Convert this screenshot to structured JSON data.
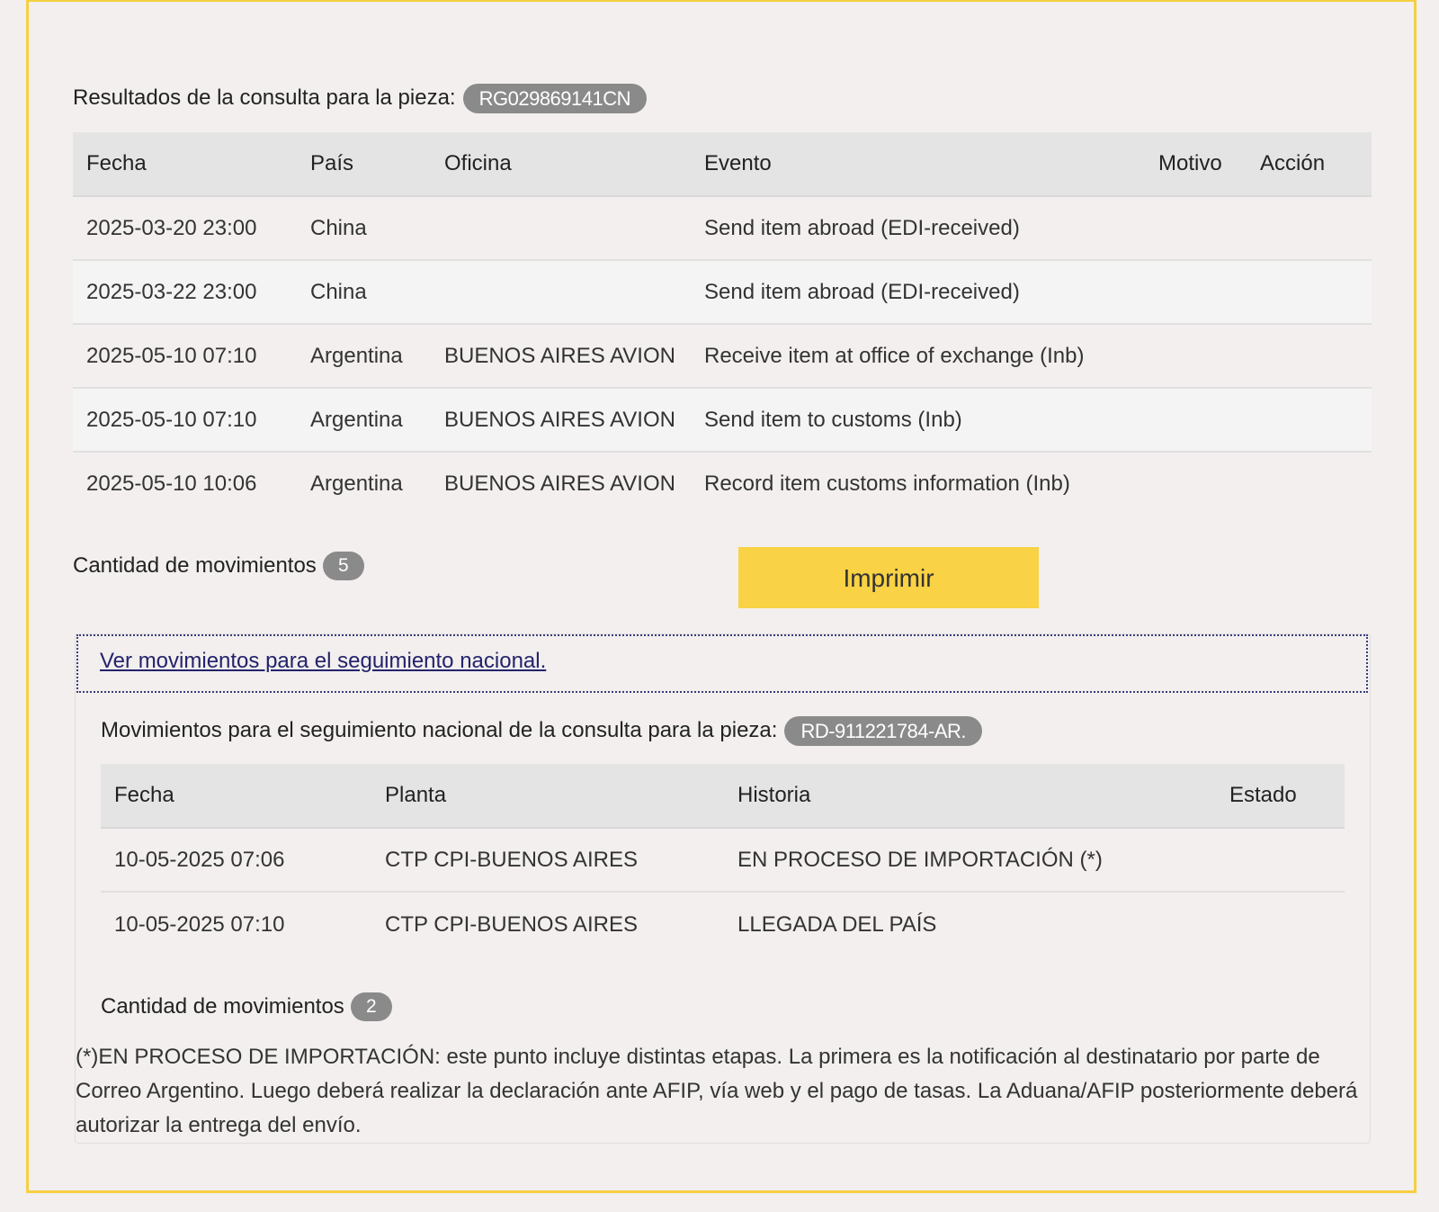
{
  "query": {
    "label": "Resultados de la consulta para la pieza:",
    "piece_id": "RG029869141CN"
  },
  "main_table": {
    "headers": [
      "Fecha",
      "País",
      "Oficina",
      "Evento",
      "Motivo",
      "Acción"
    ],
    "rows": [
      [
        "2025-03-20 23:00",
        "China",
        "",
        "Send item abroad (EDI-received)",
        "",
        ""
      ],
      [
        "2025-03-22 23:00",
        "China",
        "",
        "Send item abroad (EDI-received)",
        "",
        ""
      ],
      [
        "2025-05-10 07:10",
        "Argentina",
        "BUENOS AIRES AVION",
        "Receive item at office of exchange (Inb)",
        "",
        ""
      ],
      [
        "2025-05-10 07:10",
        "Argentina",
        "BUENOS AIRES AVION",
        "Send item to customs (Inb)",
        "",
        ""
      ],
      [
        "2025-05-10 10:06",
        "Argentina",
        "BUENOS AIRES AVION",
        "Record item customs information (Inb)",
        "",
        ""
      ]
    ]
  },
  "main_count": {
    "label": "Cantidad de movimientos",
    "value": "5"
  },
  "print_button": "Imprimir",
  "national": {
    "link_text": "Ver movimientos para el seguimiento nacional.",
    "title_label": "Movimientos para el seguimiento nacional de la consulta para la pieza:",
    "piece_id": "RD-911221784-AR.",
    "headers": [
      "Fecha",
      "Planta",
      "Historia",
      "Estado"
    ],
    "rows": [
      [
        "10-05-2025 07:06",
        "CTP CPI-BUENOS AIRES",
        "EN PROCESO DE IMPORTACIÓN (*)",
        ""
      ],
      [
        "10-05-2025 07:10",
        "CTP CPI-BUENOS AIRES",
        "LLEGADA DEL PAÍS",
        ""
      ]
    ],
    "count_label": "Cantidad de movimientos",
    "count_value": "2",
    "footnote": "(*)EN PROCESO DE IMPORTACIÓN: este punto incluye distintas etapas. La primera es la notificación al destinatario por parte de Correo Argentino. Luego deberá realizar la declaración ante AFIP, vía web y el pago de tasas. La Aduana/AFIP posteriormente deberá autorizar la entrega del envío."
  },
  "colors": {
    "accent_yellow": "#f9d245",
    "frame_border": "#f5d041",
    "pill_gray": "#8a8a8a",
    "link_blue": "#23236b",
    "background": "#f2efee"
  }
}
